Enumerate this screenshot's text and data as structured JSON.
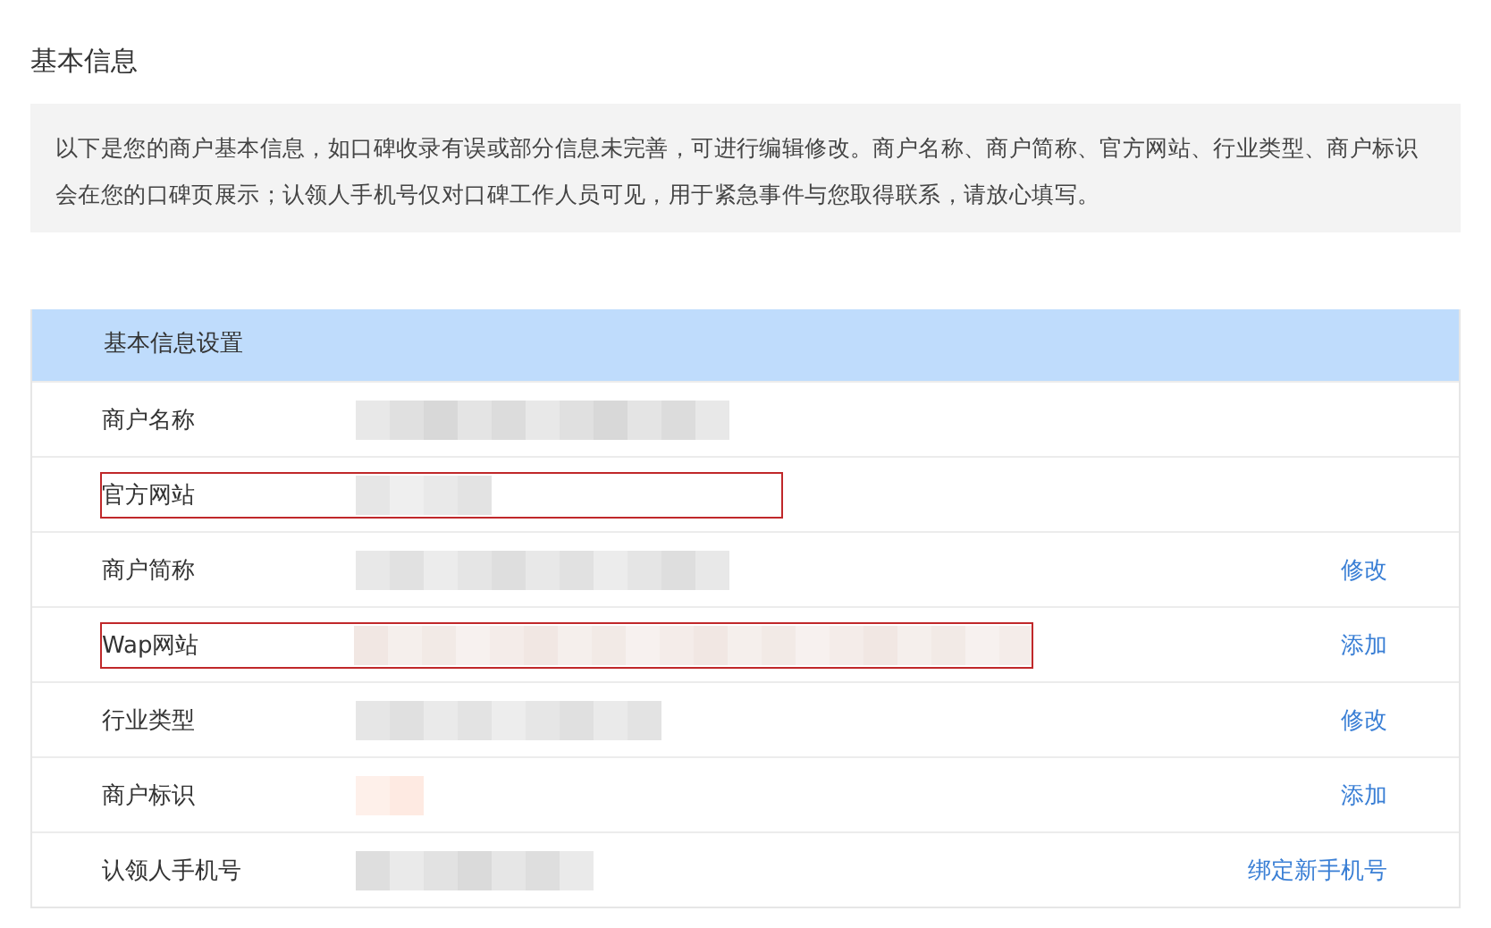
{
  "page_title": "基本信息",
  "notice": "以下是您的商户基本信息，如口碑收录有误或部分信息未完善，可进行编辑修改。商户名称、商户简称、官方网站、行业类型、商户标识会在您的口碑页展示；认领人手机号仅对口碑工作人员可见，用于紧急事件与您取得联系，请放心填写。",
  "table": {
    "title": "基本信息设置",
    "rows": [
      {
        "label": "商户名称",
        "highlighted": false
      },
      {
        "label": "官方网站",
        "highlighted": true
      },
      {
        "label": "商户简称",
        "highlighted": false,
        "action": "修改"
      },
      {
        "label": "Wap网站",
        "highlighted": true,
        "action": "添加"
      },
      {
        "label": "行业类型",
        "highlighted": false,
        "action": "修改"
      },
      {
        "label": "商户标识",
        "highlighted": false,
        "action": "添加"
      },
      {
        "label": "认领人手机号",
        "highlighted": false,
        "action": "绑定新手机号"
      }
    ]
  }
}
